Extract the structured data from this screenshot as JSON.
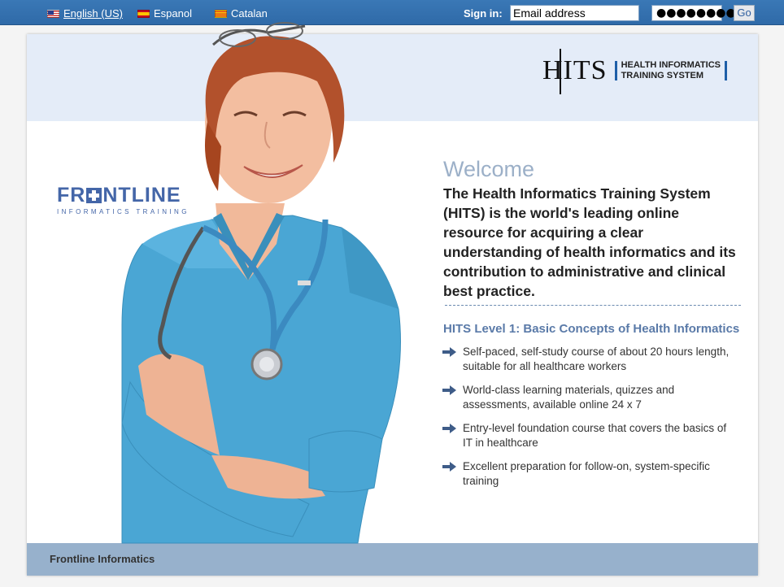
{
  "topbar": {
    "languages": [
      {
        "label": "English (US)",
        "flag": "us-flag-icon"
      },
      {
        "label": "Espanol",
        "flag": "spain-flag-icon"
      },
      {
        "label": "Catalan",
        "flag": "catalonia-flag-icon"
      }
    ],
    "signin_label": "Sign in:",
    "email_value": "Email address",
    "password_value": "●●●●●●●●",
    "go_label": "Go"
  },
  "header": {
    "hits_mark": "HITS",
    "hits_line1": "HEALTH INFORMATICS",
    "hits_line2": "TRAINING SYSTEM"
  },
  "frontline_logo": {
    "word_left": "FR",
    "word_right": "NTLINE",
    "tagline": "INFORMATICS TRAINING"
  },
  "main": {
    "welcome": "Welcome",
    "intro": "The Health Informatics Training System (HITS) is the world's leading online resource for acquiring a clear understanding of health informatics and its contribution to administrative and clinical best practice.",
    "level_title": "HITS Level 1: Basic Concepts of Health Informatics",
    "bullets": [
      "Self-paced, self-study course of about 20 hours length, suitable for all healthcare workers",
      "World-class learning materials, quizzes and assessments, available online 24 x 7",
      "Entry-level foundation course that covers the basics of IT in healthcare",
      "Excellent preparation for follow-on, system-specific training"
    ]
  },
  "footer": {
    "text": "Frontline Informatics"
  },
  "colors": {
    "topbar": "#3a78b6",
    "header_band": "#e4ecf8",
    "footer_band": "#97b1cc",
    "accent": "#1f5fa8",
    "scrubs": "#4aa6d4"
  }
}
